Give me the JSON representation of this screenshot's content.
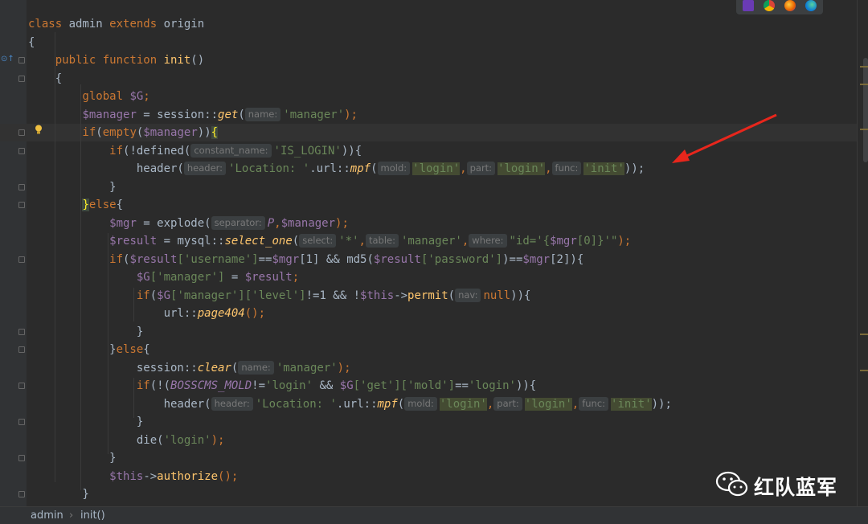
{
  "lines": [
    {
      "tokens": [
        {
          "t": "class ",
          "c": "kw"
        },
        {
          "t": "admin ",
          "c": ""
        },
        {
          "t": "extends ",
          "c": "kw"
        },
        {
          "t": "origin",
          "c": ""
        }
      ]
    },
    {
      "tokens": [
        {
          "t": "{",
          "c": ""
        }
      ]
    },
    {
      "tokens": [
        {
          "t": "    public function ",
          "c": "kw"
        },
        {
          "t": "init",
          "c": "fn"
        },
        {
          "t": "()",
          "c": ""
        }
      ]
    },
    {
      "tokens": [
        {
          "t": "    {",
          "c": ""
        }
      ]
    },
    {
      "tokens": [
        {
          "t": "        global ",
          "c": "kw"
        },
        {
          "t": "$G",
          "c": "var"
        },
        {
          "t": ";",
          "c": "kw"
        }
      ]
    },
    {
      "tokens": [
        {
          "t": "        ",
          "c": ""
        },
        {
          "t": "$manager",
          "c": "var"
        },
        {
          "t": " = session::",
          "c": ""
        },
        {
          "t": "get",
          "c": "fn ital"
        },
        {
          "t": "(",
          "c": ""
        },
        {
          "t": "name:",
          "c": "hint"
        },
        {
          "t": "'manager'",
          "c": "str"
        },
        {
          "t": ");",
          "c": "kw"
        }
      ]
    },
    {
      "current": true,
      "tokens": [
        {
          "t": "        if",
          "c": "kw"
        },
        {
          "t": "(",
          "c": ""
        },
        {
          "t": "empty",
          "c": "kw"
        },
        {
          "t": "(",
          "c": ""
        },
        {
          "t": "$manager",
          "c": "var"
        },
        {
          "t": "))",
          "c": ""
        },
        {
          "t": "{",
          "c": "brace"
        }
      ]
    },
    {
      "tokens": [
        {
          "t": "            if",
          "c": "kw"
        },
        {
          "t": "(!defined(",
          "c": ""
        },
        {
          "t": "constant_name:",
          "c": "hint"
        },
        {
          "t": "'IS_LOGIN'",
          "c": "str"
        },
        {
          "t": ")){",
          "c": ""
        }
      ]
    },
    {
      "tokens": [
        {
          "t": "                header(",
          "c": ""
        },
        {
          "t": "header:",
          "c": "hint"
        },
        {
          "t": "'Location: '",
          "c": "str"
        },
        {
          "t": ".url::",
          "c": ""
        },
        {
          "t": "mpf",
          "c": "fn ital"
        },
        {
          "t": "(",
          "c": ""
        },
        {
          "t": "mold:",
          "c": "hint"
        },
        {
          "t": "'login'",
          "c": "str hl"
        },
        {
          "t": ",",
          "c": "kw"
        },
        {
          "t": "part:",
          "c": "hint"
        },
        {
          "t": "'login'",
          "c": "str hl"
        },
        {
          "t": ",",
          "c": "kw"
        },
        {
          "t": "func:",
          "c": "hint"
        },
        {
          "t": "'init'",
          "c": "str hl"
        },
        {
          "t": "));",
          "c": ""
        }
      ]
    },
    {
      "tokens": [
        {
          "t": "            }",
          "c": ""
        }
      ]
    },
    {
      "tokens": [
        {
          "t": "        ",
          "c": ""
        },
        {
          "t": "}",
          "c": "brace"
        },
        {
          "t": "else",
          "c": "kw"
        },
        {
          "t": "{",
          "c": ""
        }
      ]
    },
    {
      "tokens": [
        {
          "t": "            ",
          "c": ""
        },
        {
          "t": "$mgr",
          "c": "var"
        },
        {
          "t": " = explode(",
          "c": ""
        },
        {
          "t": "separator:",
          "c": "hint"
        },
        {
          "t": "P",
          "c": "var ital"
        },
        {
          "t": ",",
          "c": "kw"
        },
        {
          "t": "$manager",
          "c": "var"
        },
        {
          "t": ");",
          "c": "kw"
        }
      ]
    },
    {
      "tokens": [
        {
          "t": "            ",
          "c": ""
        },
        {
          "t": "$result",
          "c": "var"
        },
        {
          "t": " = mysql::",
          "c": ""
        },
        {
          "t": "select_one",
          "c": "fn ital"
        },
        {
          "t": "(",
          "c": ""
        },
        {
          "t": "select:",
          "c": "hint"
        },
        {
          "t": "'*'",
          "c": "str"
        },
        {
          "t": ",",
          "c": "kw"
        },
        {
          "t": "table:",
          "c": "hint"
        },
        {
          "t": "'manager'",
          "c": "str"
        },
        {
          "t": ",",
          "c": "kw"
        },
        {
          "t": "where:",
          "c": "hint"
        },
        {
          "t": "\"id='{",
          "c": "str"
        },
        {
          "t": "$mgr",
          "c": "var"
        },
        {
          "t": "[0]}'\"",
          "c": "str"
        },
        {
          "t": ");",
          "c": "kw"
        }
      ]
    },
    {
      "tokens": [
        {
          "t": "            if",
          "c": "kw"
        },
        {
          "t": "(",
          "c": ""
        },
        {
          "t": "$result",
          "c": "var"
        },
        {
          "t": "['username']",
          "c": "str"
        },
        {
          "t": "==",
          "c": ""
        },
        {
          "t": "$mgr",
          "c": "var"
        },
        {
          "t": "[1] && md5(",
          "c": ""
        },
        {
          "t": "$result",
          "c": "var"
        },
        {
          "t": "['password']",
          "c": "str"
        },
        {
          "t": ")==",
          "c": ""
        },
        {
          "t": "$mgr",
          "c": "var"
        },
        {
          "t": "[2]){",
          "c": ""
        }
      ]
    },
    {
      "tokens": [
        {
          "t": "                ",
          "c": ""
        },
        {
          "t": "$G",
          "c": "var"
        },
        {
          "t": "['manager']",
          "c": "str"
        },
        {
          "t": " = ",
          "c": ""
        },
        {
          "t": "$result",
          "c": "var"
        },
        {
          "t": ";",
          "c": "kw"
        }
      ]
    },
    {
      "tokens": [
        {
          "t": "                if",
          "c": "kw"
        },
        {
          "t": "(",
          "c": ""
        },
        {
          "t": "$G",
          "c": "var"
        },
        {
          "t": "['manager']['level']",
          "c": "str"
        },
        {
          "t": "!=1 && !",
          "c": ""
        },
        {
          "t": "$this",
          "c": "var"
        },
        {
          "t": "->",
          "c": ""
        },
        {
          "t": "permit",
          "c": "fn"
        },
        {
          "t": "(",
          "c": ""
        },
        {
          "t": "nav:",
          "c": "hint"
        },
        {
          "t": "null",
          "c": "kw"
        },
        {
          "t": ")){",
          "c": ""
        }
      ]
    },
    {
      "tokens": [
        {
          "t": "                    url::",
          "c": ""
        },
        {
          "t": "page404",
          "c": "fn ital"
        },
        {
          "t": "();",
          "c": "kw"
        }
      ]
    },
    {
      "tokens": [
        {
          "t": "                }",
          "c": ""
        }
      ]
    },
    {
      "tokens": [
        {
          "t": "            }",
          "c": ""
        },
        {
          "t": "else",
          "c": "kw"
        },
        {
          "t": "{",
          "c": ""
        }
      ]
    },
    {
      "tokens": [
        {
          "t": "                session::",
          "c": ""
        },
        {
          "t": "clear",
          "c": "fn ital"
        },
        {
          "t": "(",
          "c": ""
        },
        {
          "t": "name:",
          "c": "hint"
        },
        {
          "t": "'manager'",
          "c": "str"
        },
        {
          "t": ");",
          "c": "kw"
        }
      ]
    },
    {
      "tokens": [
        {
          "t": "                if",
          "c": "kw"
        },
        {
          "t": "(!(",
          "c": ""
        },
        {
          "t": "BOSSCMS_MOLD",
          "c": "var ital"
        },
        {
          "t": "!=",
          "c": ""
        },
        {
          "t": "'login'",
          "c": "str"
        },
        {
          "t": " && ",
          "c": ""
        },
        {
          "t": "$G",
          "c": "var"
        },
        {
          "t": "['get']['mold']",
          "c": "str"
        },
        {
          "t": "==",
          "c": ""
        },
        {
          "t": "'login'",
          "c": "str"
        },
        {
          "t": ")){",
          "c": ""
        }
      ]
    },
    {
      "tokens": [
        {
          "t": "                    header(",
          "c": ""
        },
        {
          "t": "header:",
          "c": "hint"
        },
        {
          "t": "'Location: '",
          "c": "str"
        },
        {
          "t": ".url::",
          "c": ""
        },
        {
          "t": "mpf",
          "c": "fn ital"
        },
        {
          "t": "(",
          "c": ""
        },
        {
          "t": "mold:",
          "c": "hint"
        },
        {
          "t": "'login'",
          "c": "str hl"
        },
        {
          "t": ",",
          "c": "kw"
        },
        {
          "t": "part:",
          "c": "hint"
        },
        {
          "t": "'login'",
          "c": "str hl"
        },
        {
          "t": ",",
          "c": "kw"
        },
        {
          "t": "func:",
          "c": "hint"
        },
        {
          "t": "'init'",
          "c": "str hl"
        },
        {
          "t": "));",
          "c": ""
        }
      ]
    },
    {
      "tokens": [
        {
          "t": "                }",
          "c": ""
        }
      ]
    },
    {
      "tokens": [
        {
          "t": "                die(",
          "c": ""
        },
        {
          "t": "'login'",
          "c": "str"
        },
        {
          "t": ");",
          "c": "kw"
        }
      ]
    },
    {
      "tokens": [
        {
          "t": "            }",
          "c": ""
        }
      ]
    },
    {
      "tokens": [
        {
          "t": "            ",
          "c": ""
        },
        {
          "t": "$this",
          "c": "var"
        },
        {
          "t": "->",
          "c": ""
        },
        {
          "t": "authorize",
          "c": "fn"
        },
        {
          "t": "();",
          "c": "kw"
        }
      ]
    },
    {
      "tokens": [
        {
          "t": "        }",
          "c": ""
        }
      ]
    }
  ],
  "breadcrumb": {
    "class_name": "admin",
    "separator": "›",
    "method_name": "init()"
  },
  "watermark": {
    "text": "红队蓝军"
  },
  "colors": {
    "annotation_arrow": "#e8261c",
    "accent": "#cc7832"
  }
}
